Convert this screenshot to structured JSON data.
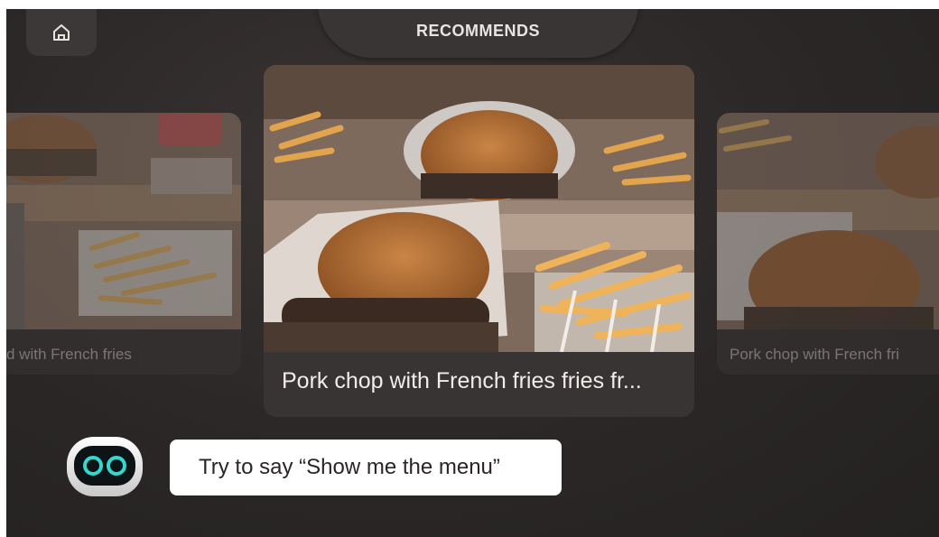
{
  "header": {
    "home_icon": "home-icon",
    "title": "RECOMMENDS"
  },
  "carousel": {
    "left_card": {
      "caption": "d with French fries"
    },
    "center_card": {
      "caption": "Pork chop with French fries fries fr..."
    },
    "right_card": {
      "caption": "Pork chop with French fri"
    }
  },
  "assistant": {
    "avatar_icon": "robot-icon",
    "prompt": "Try to say “Show me the menu”"
  },
  "colors": {
    "background": "#2b2727",
    "card": "#393434",
    "badge": "#c85a5a",
    "speech_bubble": "#ffffff"
  }
}
